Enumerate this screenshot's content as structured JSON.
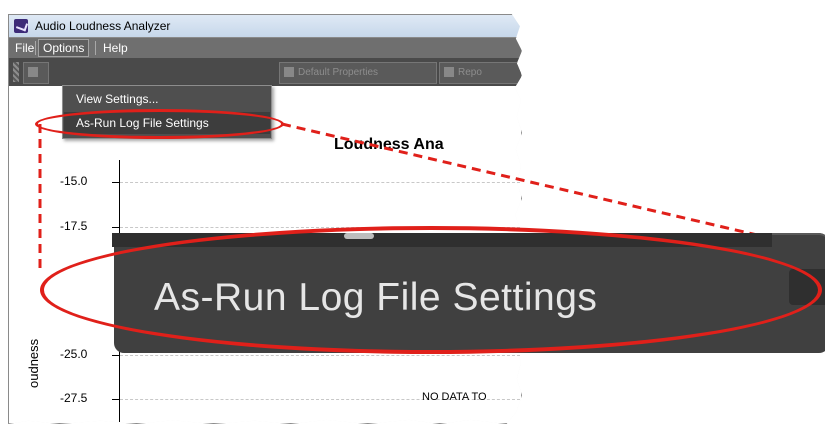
{
  "window": {
    "title": "Audio Loudness Analyzer"
  },
  "menubar": {
    "file": "File",
    "options": "Options",
    "help": "Help"
  },
  "toolbar": {
    "default_properties": "Default Properties",
    "report_truncated": "Repo"
  },
  "options_menu": {
    "items": [
      "View Settings...",
      "As-Run Log File Settings"
    ]
  },
  "chart": {
    "title_truncated": "Loudness Ana",
    "ylabel_truncated": "oudness",
    "y_ticks": [
      "-15.0",
      "-17.5",
      "-25.0",
      "-27.5"
    ],
    "no_data_truncated": "NO DATA TO"
  },
  "callout": {
    "zoom_text": "As-Run Log File Settings",
    "color": "#e0201a"
  },
  "chart_data": {
    "type": "line",
    "title": "Loudness Ana",
    "ylabel": "oudness",
    "y_ticks": [
      -15.0,
      -17.5,
      -25.0,
      -27.5
    ],
    "series": []
  }
}
